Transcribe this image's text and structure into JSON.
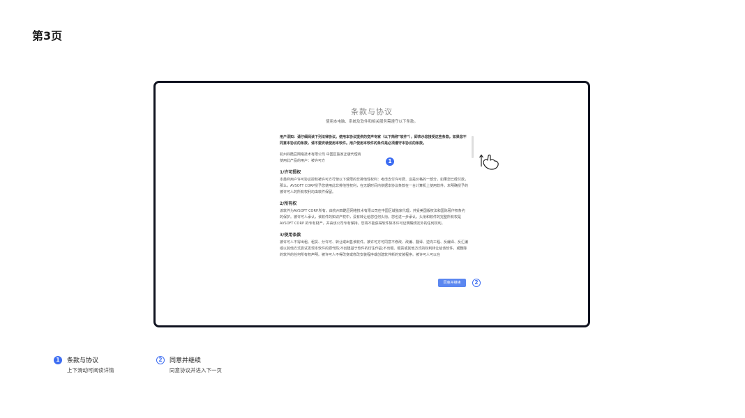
{
  "page": {
    "title": "第3页"
  },
  "dialog": {
    "title": "条款与协议",
    "subtitle": "使用本电脑、系统及软件和相关服务需遵守以下条款。",
    "notice": "用户须知：请仔细阅读下列法律协议。使用本协议提供的变声专家（以下简称\"软件\"），即表示您接受这些条款。如果您不同意本协议的条款，请不要安装使用本软件。用户使用本软件的条件是必须遵守本协议的条款。",
    "licensor_line": "杭州四酷豆网络技术有限公司 中国区独家正版代理商",
    "licensee_line": "使用此产品的用户：被许可方",
    "sections": [
      {
        "heading": "1/许可授权",
        "body": "本最终用户许可协议授权被许可方行使以下受限的非排他性权利：考虑支付许可费、这是价格的一部分，如果您已经付款，那么，AVSOFT CORP授予您使用此非排他性权利，在无期时间内依据本协议条款在一台计算机上使用软件。未明确授予的被许可人的所有权利均由软件保留。"
      },
      {
        "heading": "2/所有权",
        "body": "该软件为AVSOFT CORP.所有，由杭州四酷豆网络技术有限公司在中国区域独家代理，并受美国版权法和国际著作权条约的保护。被许可人承认，该软件的知识产权中，没有转让给您任何头衔。您也进一步承认，头衔和软件的完整所有权是AVSOFT CORP 的专有财产，并由该公司专有保持。您将不能获得软件除本许可证明确规定外的任何权利。"
      },
      {
        "heading": "3/使用条款",
        "body": "被许可人不得出租、租赁、分许可、转让或出售该软件。被许可方可同意不修改、改编、翻译、逆向工程、反编译、反汇编或以其他方式尝试发现本软件的源代码;不创建基于软件的衍生作品;不出租、租赁或其他方式的权利转让给该软件，或删除的软件的任何所有权声明。被许可人不得改变或修改安装程序或创建软件新的安装程序。被许可人可以在"
      }
    ],
    "agree_button": "同意并继续"
  },
  "markers": {
    "one": "1",
    "two": "2"
  },
  "legend": [
    {
      "number": "1",
      "title": "条款与协议",
      "desc": "上下滑动可阅读详情"
    },
    {
      "number": "2",
      "title": "同意并继续",
      "desc": "同意协议并进入下一页"
    }
  ],
  "icons": {
    "scroll_hint": "hand-swipe-icon"
  },
  "colors": {
    "accent": "#3d6df2",
    "button": "#5b87f0",
    "frame": "#101320"
  }
}
